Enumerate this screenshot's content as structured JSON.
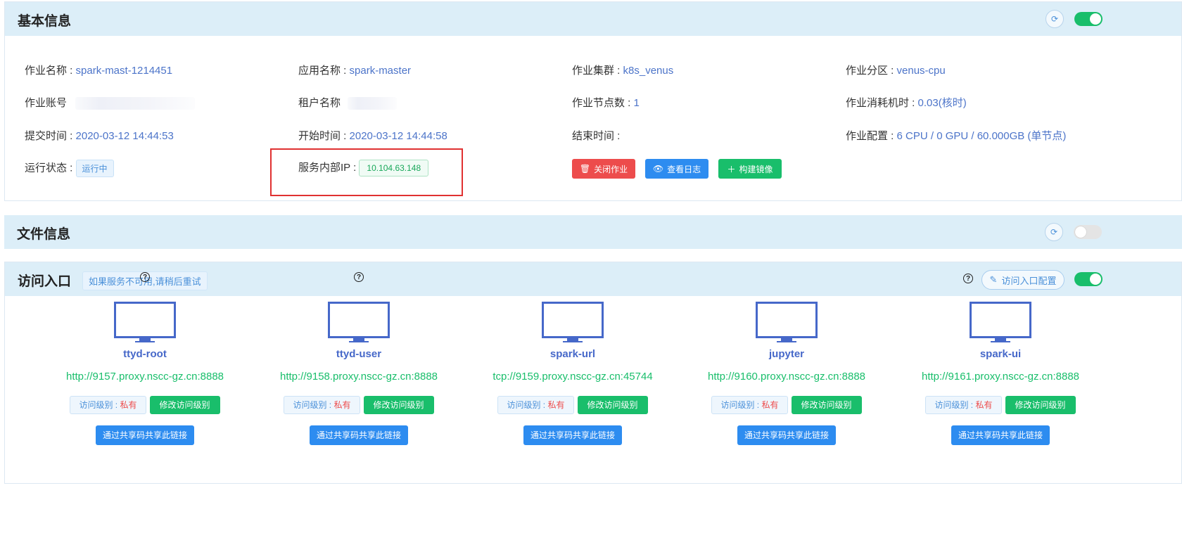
{
  "basic": {
    "title": "基本信息",
    "toggle_on": true,
    "fields": {
      "job_name_label": "作业名称 : ",
      "job_name": "spark-mast-1214451",
      "app_name_label": "应用名称 : ",
      "app_name": "spark-master",
      "cluster_label": "作业集群 : ",
      "cluster": "k8s_venus",
      "partition_label": "作业分区 : ",
      "partition": "venus-cpu",
      "account_label": "作业账号",
      "tenant_label": "租户名称",
      "nodes_label": "作业节点数 : ",
      "nodes": "1",
      "cost_label": "作业消耗机时 : ",
      "cost": "0.03(核时)",
      "submit_label": "提交时间 : ",
      "submit": "2020-03-12 14:44:53",
      "start_label": "开始时间 : ",
      "start": "2020-03-12 14:44:58",
      "end_label": "结束时间 : ",
      "end": "",
      "config_label": "作业配置 : ",
      "config": "6 CPU / 0 GPU / 60.000GB (单节点)",
      "status_label": "运行状态 : ",
      "status": "运行中",
      "ip_label": "服务内部IP : ",
      "ip": "10.104.63.148"
    },
    "actions": {
      "close": "关闭作业",
      "logs": "查看日志",
      "build": "构建镜像"
    }
  },
  "files": {
    "title": "文件信息",
    "toggle_on": false
  },
  "access": {
    "title": "访问入口",
    "hint": "如果服务不可用,请稍后重试",
    "config_button": "访问入口配置",
    "toggle_on": true,
    "help_glyph": "?",
    "level_label": "访问级别 : ",
    "private_label": "私有",
    "modify_label": "修改访问级别",
    "share_label": "通过共享码共享此链接",
    "entries": [
      {
        "name": "ttyd-root",
        "url": "http://9157.proxy.nscc-gz.cn:8888",
        "has_help": true
      },
      {
        "name": "ttyd-user",
        "url": "http://9158.proxy.nscc-gz.cn:8888",
        "has_help": true
      },
      {
        "name": "spark-url",
        "url": "tcp://9159.proxy.nscc-gz.cn:45744",
        "has_help": false
      },
      {
        "name": "jupyter",
        "url": "http://9160.proxy.nscc-gz.cn:8888",
        "has_help": false
      },
      {
        "name": "spark-ui",
        "url": "http://9161.proxy.nscc-gz.cn:8888",
        "has_help": false
      }
    ]
  },
  "colors": {
    "header_bg": "#dceef8",
    "link_blue": "#4c74c9",
    "url_green": "#19be6b",
    "danger_red": "#ed4c4c",
    "primary_blue": "#2d8cf0",
    "highlight_red": "#e03131"
  }
}
